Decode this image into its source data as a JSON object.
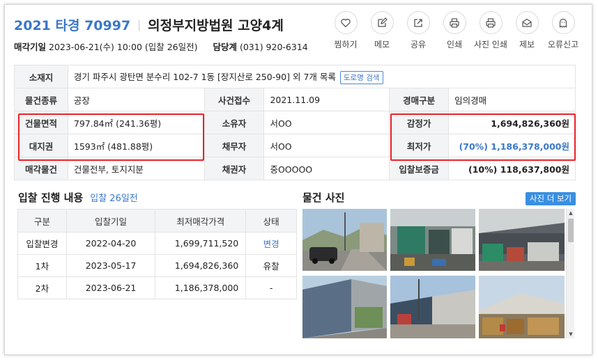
{
  "header": {
    "case_number": "2021 타경 70997",
    "court": "의정부지방법원 고양4계",
    "sale_date_label": "매각기일",
    "sale_date_value": "2023-06-21(수) 10:00 (입찰 26일전)",
    "dept_label": "담당계",
    "dept_phone": "(031) 920-6314"
  },
  "actions": [
    {
      "label": "찜하기",
      "icon": "heart-icon"
    },
    {
      "label": "메모",
      "icon": "edit-icon"
    },
    {
      "label": "공유",
      "icon": "share-icon"
    },
    {
      "label": "인쇄",
      "icon": "printer-icon"
    },
    {
      "label": "사진 인쇄",
      "icon": "printer-icon"
    },
    {
      "label": "제보",
      "icon": "envelope-icon"
    },
    {
      "label": "오류신고",
      "icon": "ghost-icon"
    }
  ],
  "info": {
    "location_label": "소재지",
    "location_value": "경기 파주시 광탄면 분수리 102-7 1동 [장지산로 250-90] 외 7개 목록",
    "road_search_button": "도로명 검색",
    "type_label": "물건종류",
    "type_value": "공장",
    "received_label": "사건접수",
    "received_value": "2021.11.09",
    "sale_kind_label": "경매구분",
    "sale_kind_value": "임의경매",
    "building_area_label": "건물면적",
    "building_area_value": "797.84㎡ (241.36평)",
    "owner_label": "소유자",
    "owner_value": "서OO",
    "appraisal_label": "감정가",
    "appraisal_value": "1,694,826,360원",
    "land_label": "대지권",
    "land_value": "1593㎡ (481.88평)",
    "debtor_label": "채무자",
    "debtor_value": "서OO",
    "min_price_label": "최저가",
    "min_price_value": "(70%) 1,186,378,000원",
    "sale_item_label": "매각물건",
    "sale_item_value": "건물전부, 토지지분",
    "creditor_label": "채권자",
    "creditor_value": "중OOOOO",
    "deposit_label": "입찰보증금",
    "deposit_value": "(10%) 118,637,800원"
  },
  "history": {
    "title": "입찰 진행 내용",
    "days_link": "입찰 26일전",
    "columns": [
      "구분",
      "입찰기일",
      "최저매각가격",
      "상태"
    ],
    "rows": [
      {
        "round": "입찰변경",
        "date": "2022-04-20",
        "price": "1,699,711,520",
        "status": "변경"
      },
      {
        "round": "1차",
        "date": "2023-05-17",
        "price": "1,694,826,360",
        "status": "유찰"
      },
      {
        "round": "2차",
        "date": "2023-06-21",
        "price": "1,186,378,000",
        "status": "-"
      }
    ]
  },
  "photos": {
    "title": "물건 사진",
    "more_button": "사진 더 보기"
  },
  "colors": {
    "accent_blue": "#3a78c9",
    "highlight_red": "#e8232a",
    "header_gray": "#f3f4f6"
  }
}
